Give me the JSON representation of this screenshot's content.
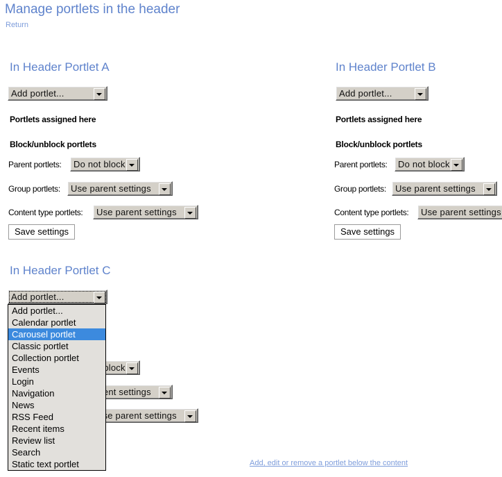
{
  "header": {
    "title": "Manage portlets in the header",
    "return_label": "Return"
  },
  "columns": [
    {
      "heading": "In Header Portlet A",
      "add_portlet_value": "Add portlet...",
      "assigned_heading": "Portlets assigned here",
      "block_heading": "Block/unblock portlets",
      "parent_label": "Parent portlets:",
      "parent_value": "Do not block",
      "group_label": "Group portlets:",
      "group_value": "Use parent settings",
      "content_label": "Content type portlets:",
      "content_value": "Use parent settings",
      "save_label": "Save settings"
    },
    {
      "heading": "In Header Portlet B",
      "add_portlet_value": "Add portlet...",
      "assigned_heading": "Portlets assigned here",
      "block_heading": "Block/unblock portlets",
      "parent_label": "Parent portlets:",
      "parent_value": "Do not block",
      "group_label": "Group portlets:",
      "group_value": "Use parent settings",
      "content_label": "Content type portlets:",
      "content_value": "Use parent settings",
      "save_label": "Save settings"
    },
    {
      "heading": "In Header Portlet C",
      "add_portlet_value": "Add portlet...",
      "parent_value": "Do not block",
      "group_value": "Use parent settings",
      "content_value": "Use parent settings"
    }
  ],
  "dropdown": {
    "selected": "Carousel portlet",
    "options": [
      "Add portlet...",
      "Calendar portlet",
      "Carousel portlet",
      "Classic portlet",
      "Collection portlet",
      "Events",
      "Login",
      "Navigation",
      "News",
      "RSS Feed",
      "Recent items",
      "Review list",
      "Search",
      "Static text portlet"
    ]
  },
  "footer": {
    "link_label": "Add, edit or remove a portlet below the content"
  },
  "colors": {
    "heading_blue": "#5f83cc",
    "link_blue": "#7e9ddb",
    "highlight_blue": "#3c8ade",
    "control_face": "#d4d0c8"
  }
}
